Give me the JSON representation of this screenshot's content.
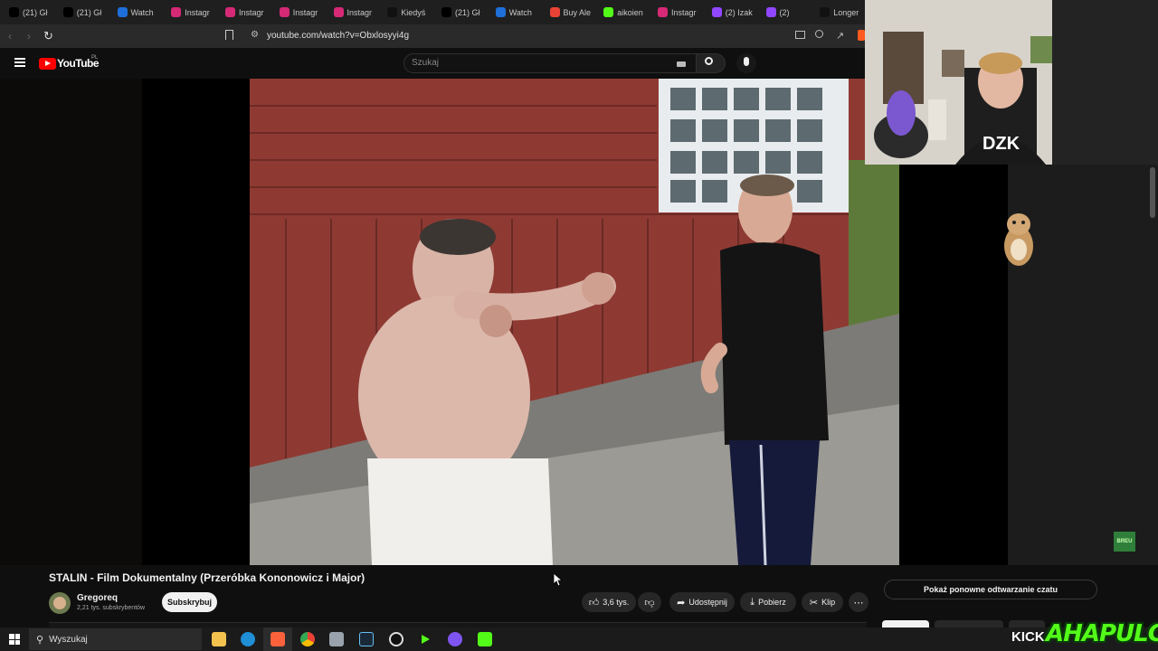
{
  "tabs": [
    {
      "label": "(21) Gł",
      "icon": "x-icon",
      "color": "#000000"
    },
    {
      "label": "(21) Gł",
      "icon": "x-icon",
      "color": "#000000"
    },
    {
      "label": "Watch",
      "icon": "watch-icon",
      "color": "#1e6fd9"
    },
    {
      "label": "Instagr",
      "icon": "instagram-icon",
      "color": "#d62976"
    },
    {
      "label": "Instagr",
      "icon": "instagram-icon",
      "color": "#d62976"
    },
    {
      "label": "Instagr",
      "icon": "instagram-icon",
      "color": "#d62976"
    },
    {
      "label": "Instagr",
      "icon": "instagram-icon",
      "color": "#d62976"
    },
    {
      "label": "Kiedyś",
      "icon": "tiktok-icon",
      "color": "#111111"
    },
    {
      "label": "(21) Gł",
      "icon": "x-icon",
      "color": "#000000"
    },
    {
      "label": "Watch",
      "icon": "watch-icon",
      "color": "#1e6fd9"
    },
    {
      "label": "Buy Ale",
      "icon": "google-icon",
      "color": "#ea4335"
    },
    {
      "label": "aikoien",
      "icon": "kick-icon",
      "color": "#53fc18"
    },
    {
      "label": "Instagr",
      "icon": "instagram-icon",
      "color": "#d62976"
    },
    {
      "label": "(2) Izak",
      "icon": "twitch-icon",
      "color": "#9146ff"
    },
    {
      "label": "(2)",
      "icon": "twitch-icon",
      "color": "#9146ff"
    },
    {
      "label": "Longer",
      "icon": "tiktok-icon",
      "color": "#111111"
    }
  ],
  "address": {
    "url": "youtube.com/watch?v=Obxlosyyi4g"
  },
  "youtube": {
    "logo_text": "YouTube",
    "region": "PL",
    "search_placeholder": "Szukaj"
  },
  "video": {
    "title": "STALIN - Film Dokumentalny (Przeróbka Kononowicz i Major)",
    "channel": "Gregoreq",
    "subscribers": "2,21 tys. subskrybentów",
    "subscribe_label": "Subskrybuj",
    "likes": "3,6 tys.",
    "share_label": "Udostępnij",
    "download_label": "Pobierz",
    "clip_label": "Klip"
  },
  "chat": {
    "replay_label": "Pokaż ponowne odtwarzanie czatu"
  },
  "overlay": {
    "kick": "KICK",
    "brand": "AHAPULCO",
    "badge": "BREU",
    "cam_shirt": "DZK"
  },
  "taskbar": {
    "search_placeholder": "Wyszukaj"
  },
  "colors": {
    "accent": "#ff0000",
    "subscribe_bg": "#f1f1f1",
    "kick_green": "#53fc18"
  }
}
